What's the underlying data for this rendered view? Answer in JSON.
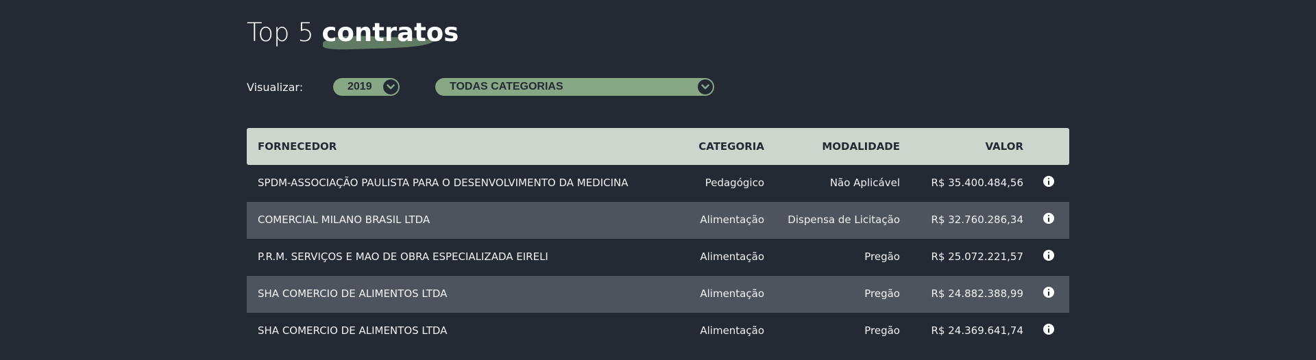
{
  "header": {
    "title_light": "Top 5 ",
    "title_bold": "contratos"
  },
  "filters": {
    "label": "Visualizar:",
    "year": "2019",
    "category": "TODAS CATEGORIAS"
  },
  "table": {
    "columns": {
      "fornecedor": "FORNECEDOR",
      "categoria": "CATEGORIA",
      "modalidade": "MODALIDADE",
      "valor": "VALOR"
    },
    "rows": [
      {
        "fornecedor": "SPDM-ASSOCIAÇÃO PAULISTA PARA O DESENVOLVIMENTO DA MEDICINA",
        "categoria": "Pedagógico",
        "modalidade": "Não Aplicável",
        "valor": "R$ 35.400.484,56"
      },
      {
        "fornecedor": "COMERCIAL MILANO BRASIL LTDA",
        "categoria": "Alimentação",
        "modalidade": "Dispensa de Licitação",
        "valor": "R$ 32.760.286,34"
      },
      {
        "fornecedor": "P.R.M. SERVIÇOS E MAO DE OBRA ESPECIALIZADA EIRELI",
        "categoria": "Alimentação",
        "modalidade": "Pregão",
        "valor": "R$ 25.072.221,57"
      },
      {
        "fornecedor": "SHA COMERCIO DE ALIMENTOS LTDA",
        "categoria": "Alimentação",
        "modalidade": "Pregão",
        "valor": "R$ 24.882.388,99"
      },
      {
        "fornecedor": "SHA COMERCIO DE ALIMENTOS LTDA",
        "categoria": "Alimentação",
        "modalidade": "Pregão",
        "valor": "R$ 24.369.641,74"
      }
    ]
  },
  "colors": {
    "background": "#232a34",
    "accent": "#87a785",
    "header_row": "#cbd6cd",
    "alt_row": "#4d545d"
  },
  "icons": [
    "chevron-down-icon",
    "info-icon"
  ]
}
